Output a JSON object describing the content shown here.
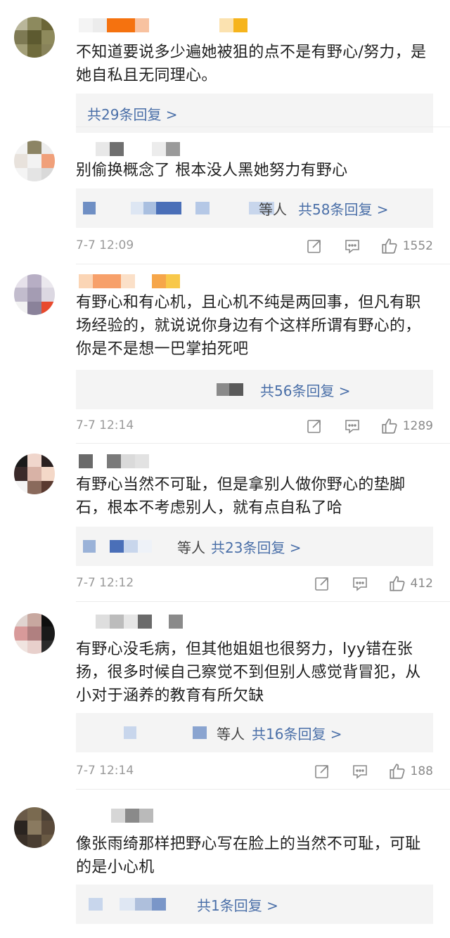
{
  "comments": [
    {
      "text": "不知道要说多少遍她被狙的点不是有野心/努力，是她自私且无同理心。",
      "reply_prefix": "",
      "reply_label": "共29条回复 >",
      "time": "",
      "likes": ""
    },
    {
      "text": "别偷换概念了 根本没人黑她努力有野心",
      "reply_prefix": "等人",
      "reply_label": "共58条回复 >",
      "time": "7-7 12:09",
      "likes": "1552"
    },
    {
      "text": "有野心和有心机，且心机不纯是两回事，但凡有职场经验的，就说说你身边有个这样所谓有野心的，你是不是想一巴掌拍死吧",
      "reply_prefix": "",
      "reply_label": "共56条回复 >",
      "time": "7-7 12:14",
      "likes": "1289"
    },
    {
      "text": "有野心当然不可耻，但是拿别人做你野心的垫脚石，根本不考虑别人，就有点自私了哈",
      "reply_prefix": "等人",
      "reply_label": "共23条回复 >",
      "time": "7-7 12:12",
      "likes": "412"
    },
    {
      "text": "有野心没毛病，但其他姐姐也很努力，lyy错在张扬，很多时候自己察觉不到但别人感觉背冒犯，从小对于涵养的教育有所欠缺",
      "reply_prefix": "等人",
      "reply_label": "共16条回复 >",
      "time": "7-7 12:14",
      "likes": "188"
    },
    {
      "text": "像张雨绮那样把野心写在脸上的当然不可耻，可耻的是小心机",
      "reply_prefix": "",
      "reply_label": "共1条回复 >",
      "time": "",
      "likes": ""
    }
  ],
  "icons": {
    "share": "share-icon",
    "comment": "comment-icon",
    "like": "like-icon"
  },
  "colors": {
    "reply_link": "#4a6fa8",
    "meta": "#9a9a9a",
    "reply_bg": "#f4f4f4"
  }
}
